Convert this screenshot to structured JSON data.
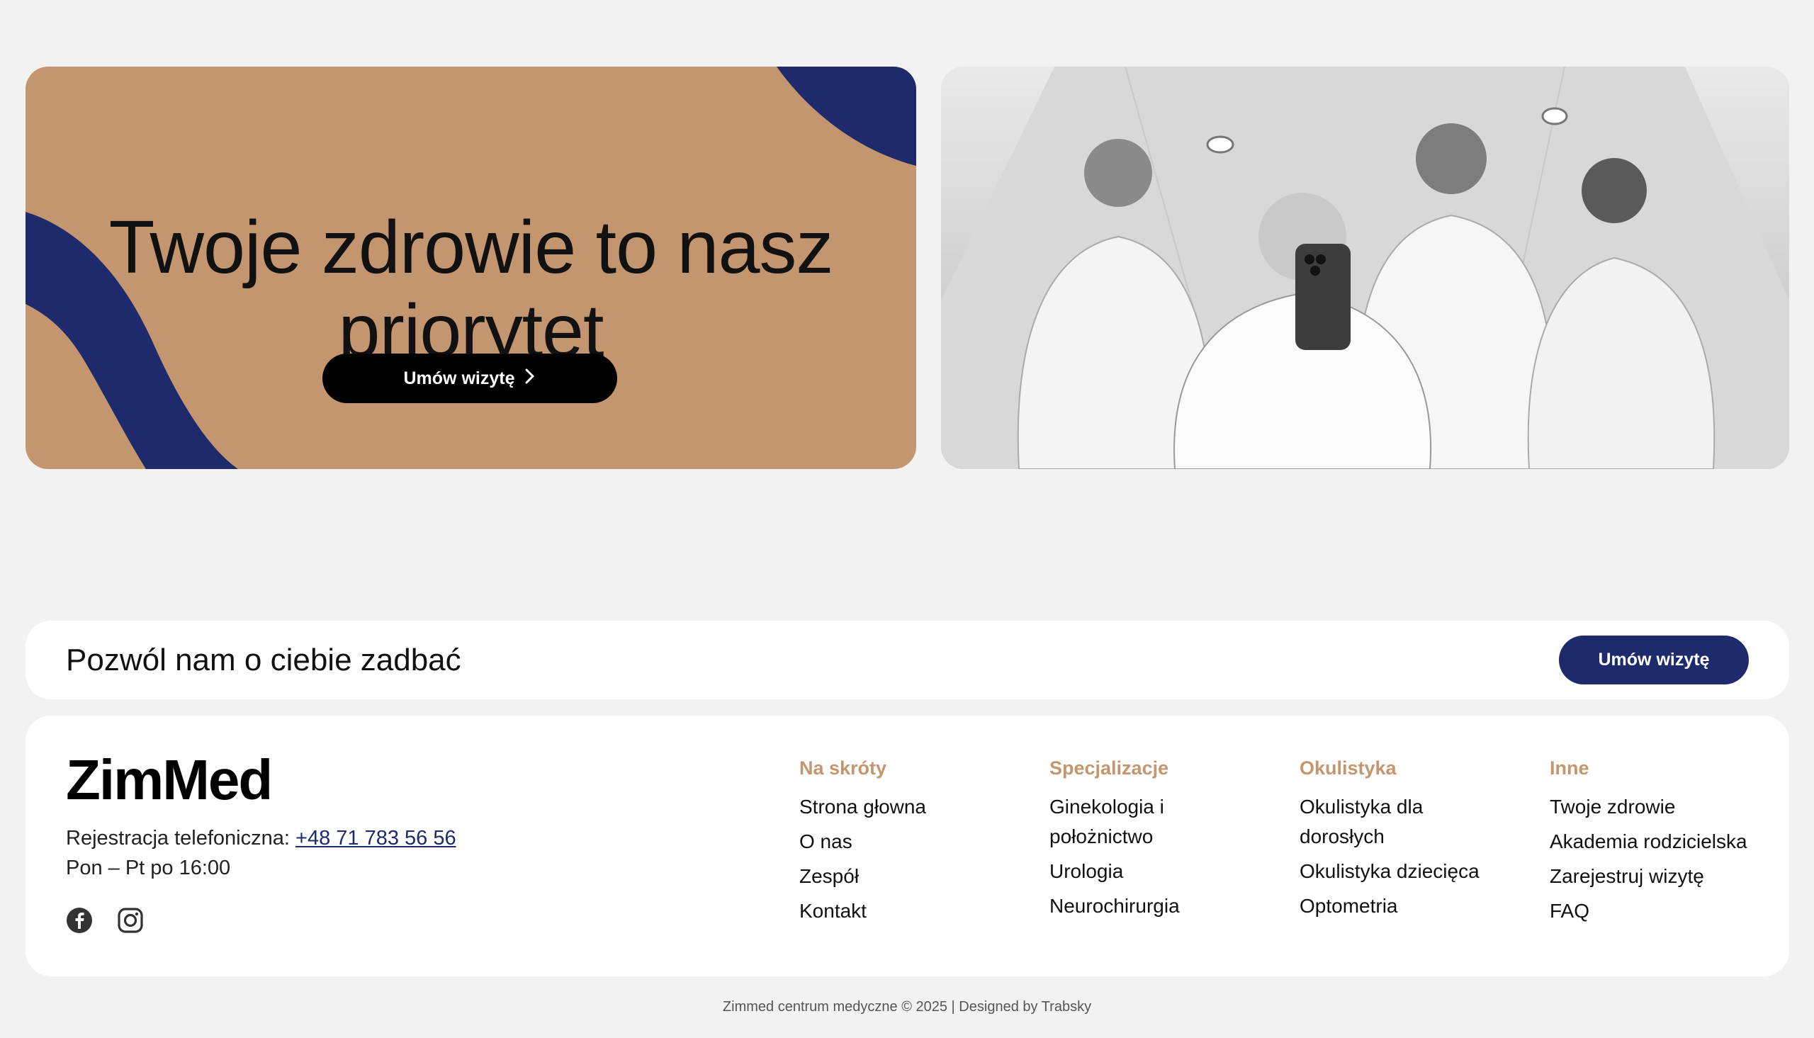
{
  "hero": {
    "title": "Twoje zdrowie to nasz priorytet",
    "button_label": "Umów wizytę",
    "colors": {
      "card": "#c4966f",
      "accent": "#1e2a6b",
      "button": "#000000"
    }
  },
  "photo": {
    "icon": "doctors-group-photo"
  },
  "cta": {
    "text": "Pozwól nam o ciebie zadbać",
    "button_label": "Umów wizytę"
  },
  "footer": {
    "logo": "ZimMed",
    "phone_label": "Rejestracja telefoniczna:",
    "phone": "+48 71 783 56 56",
    "hours": "Pon – Pt po 16:00",
    "socials": [
      "facebook-icon",
      "instagram-icon"
    ],
    "columns": [
      {
        "title": "Na skróty",
        "items": [
          "Strona głowna",
          "O nas",
          "Zespół",
          "Kontakt"
        ]
      },
      {
        "title": "Specjalizacje",
        "items": [
          "Ginekologia i położnictwo",
          "Urologia",
          "Neurochirurgia"
        ]
      },
      {
        "title": "Okulistyka",
        "items": [
          "Okulistyka dla dorosłych",
          "Okulistyka dziecięca",
          "Optometria"
        ]
      },
      {
        "title": "Inne",
        "items": [
          "Twoje zdrowie",
          "Akademia rodzicielska",
          "Zarejestruj wizytę",
          "FAQ"
        ]
      }
    ]
  },
  "copyright": "Zimmed centrum medyczne © 2025 | Designed by Trabsky"
}
